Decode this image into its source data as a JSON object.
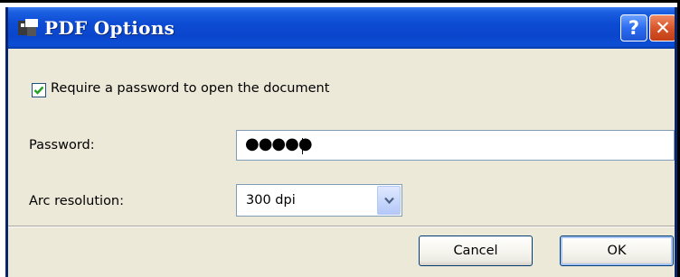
{
  "window": {
    "title": "PDF Options",
    "help_glyph": "?",
    "close_glyph": "✕"
  },
  "require_password": {
    "label": "Require a password to open the document",
    "checked": true
  },
  "password": {
    "label": "Password:",
    "value": "●●●●●"
  },
  "arc_resolution": {
    "label": "Arc resolution:",
    "selected": "300 dpi"
  },
  "buttons": {
    "cancel": "Cancel",
    "ok": "OK"
  },
  "icons": {
    "title": "pdf-options-app-icon",
    "help": "help-icon",
    "close": "close-icon",
    "check": "checkmark-icon",
    "dropdown": "chevron-down-icon"
  },
  "colors": {
    "titlebar": "#0a46cc",
    "dialog_bg": "#ece9d8",
    "close_button": "#d8562c",
    "help_button": "#2d6cf0",
    "checkmark": "#21a121"
  }
}
